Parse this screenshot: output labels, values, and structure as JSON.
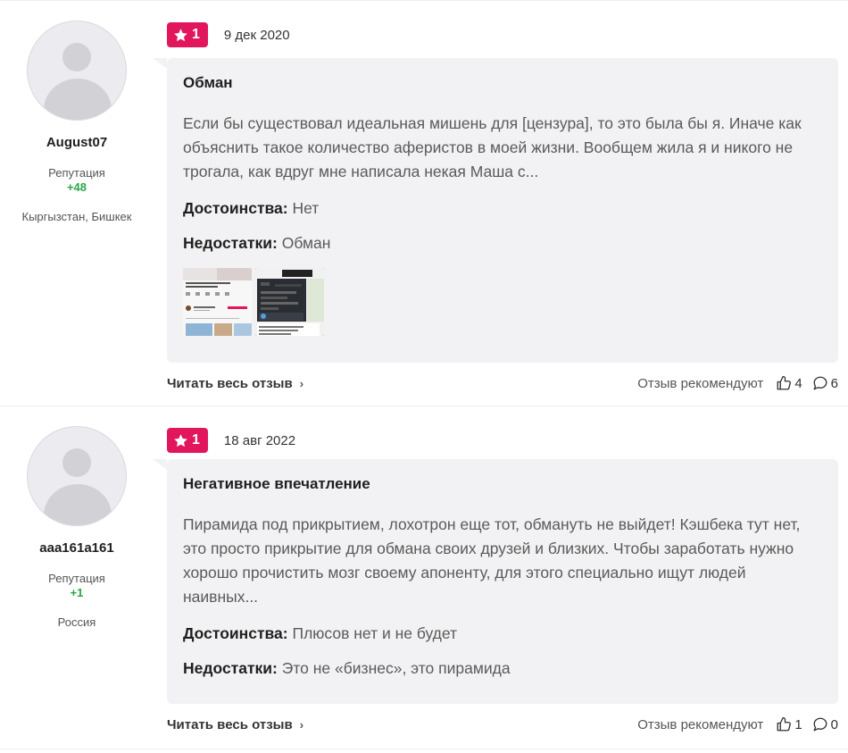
{
  "reviews": [
    {
      "author": {
        "name": "August07",
        "reputation_label": "Репутация",
        "reputation_value": "+48",
        "location": "Кыргызстан, Бишкек"
      },
      "rating": "1",
      "date": "9 дек 2020",
      "title": "Обман",
      "text": "Если бы существовал идеальная мишень для [цензура], то это была бы я. Иначе как объяснить такое количество аферистов в моей жизни. Вообщем жила я и никого не трогала, как вдруг мне написала некая Маша с...",
      "pros_label": "Достоинства:",
      "pros": "Нет",
      "cons_label": "Недостатки:",
      "cons": "Обман",
      "read_more": "Читать весь отзыв",
      "recommend_label": "Отзыв рекомендуют",
      "likes": "4",
      "comments": "6"
    },
    {
      "author": {
        "name": "aaa161a161",
        "reputation_label": "Репутация",
        "reputation_value": "+1",
        "location": "Россия"
      },
      "rating": "1",
      "date": "18 авг 2022",
      "title": "Негативное впечатление",
      "text": "Пирамида под прикрытием, лохотрон еще тот, обмануть не выйдет! Кэшбека тут нет, это просто прикрытие для обмана своих друзей и близких. Чтобы заработать нужно хорошо прочистить мозг своему апоненту, для этого специально ищут людей наивных...",
      "pros_label": "Достоинства:",
      "pros": "Плюсов нет и не будет",
      "cons_label": "Недостатки:",
      "cons": "Это не «бизнес», это пирамида",
      "read_more": "Читать весь отзыв",
      "recommend_label": "Отзыв рекомендуют",
      "likes": "1",
      "comments": "0"
    }
  ],
  "colors": {
    "rating_badge": "#e1165c",
    "reputation_positive": "#2aa845",
    "card_bg": "#f2f2f4"
  },
  "icons": {
    "rating": "star-icon",
    "like": "thumbs-up-icon",
    "comment": "comment-icon",
    "read_more": "chevron-right-icon"
  }
}
